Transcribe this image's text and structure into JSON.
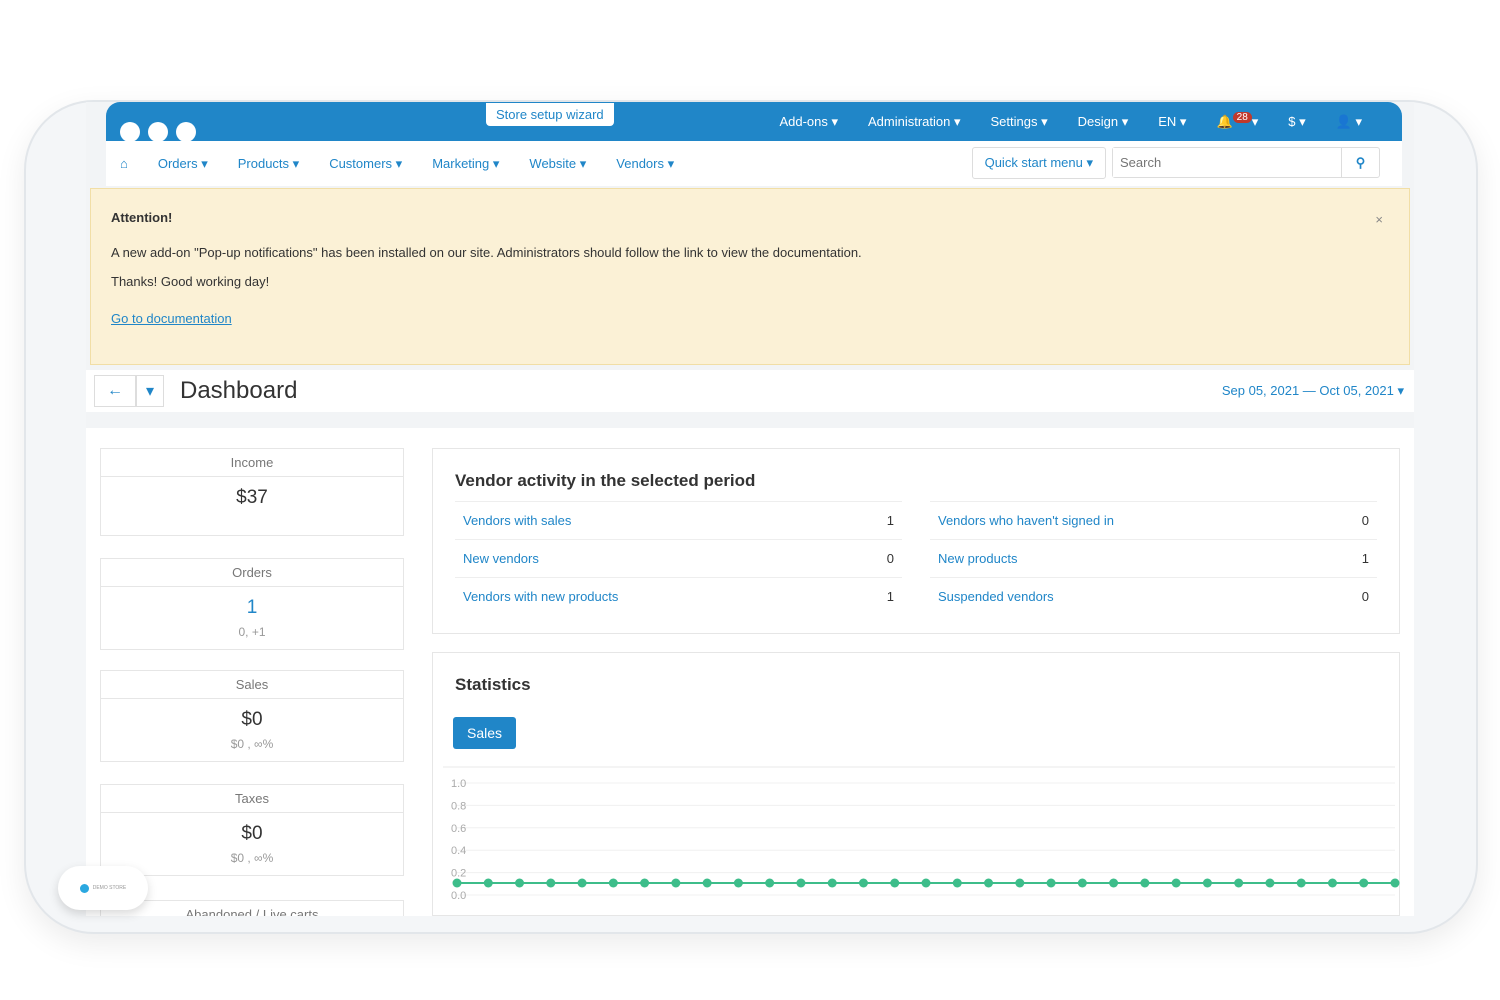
{
  "topbar": {
    "wizard": "Store setup wizard",
    "menu": [
      "Add-ons",
      "Administration",
      "Settings",
      "Design",
      "EN"
    ],
    "notifications": "28",
    "currency": "$"
  },
  "nav": {
    "items": [
      "Orders",
      "Products",
      "Customers",
      "Marketing",
      "Website",
      "Vendors"
    ],
    "quick_start": "Quick start menu",
    "search_placeholder": "Search"
  },
  "alert": {
    "title": "Attention!",
    "message": "A new add-on \"Pop-up notifications\" has been installed on our site. Administrators should follow the link to view the documentation.",
    "thanks": "Thanks! Good working day!",
    "link": "Go to documentation"
  },
  "dashboard": {
    "title": "Dashboard",
    "date_range": "Sep 05, 2021 — Oct 05, 2021"
  },
  "cards": [
    {
      "title": "Income",
      "value": "$37",
      "sub": ""
    },
    {
      "title": "Orders",
      "value": "1",
      "sub": "0, +1"
    },
    {
      "title": "Sales",
      "value": "$0",
      "sub": "$0 , ∞%"
    },
    {
      "title": "Taxes",
      "value": "$0",
      "sub": "$0 , ∞%"
    },
    {
      "title": "Abandoned / Live carts",
      "value": "",
      "sub": ""
    }
  ],
  "vendor_activity": {
    "title": "Vendor activity in the selected period",
    "rows": [
      {
        "label": "Vendors with sales",
        "value": "1"
      },
      {
        "label": "Vendors who haven't signed in",
        "value": "0"
      },
      {
        "label": "New vendors",
        "value": "0"
      },
      {
        "label": "New products",
        "value": "1"
      },
      {
        "label": "Vendors with new products",
        "value": "1"
      },
      {
        "label": "Suspended vendors",
        "value": "0"
      }
    ]
  },
  "statistics": {
    "title": "Statistics",
    "tab": "Sales"
  },
  "demo_badge": "DEMO STORE",
  "chart_data": {
    "type": "line",
    "title": "",
    "xlabel": "",
    "ylabel": "",
    "ylim": [
      0,
      1
    ],
    "yticks": [
      "0.0",
      "0.2",
      "0.4",
      "0.6",
      "0.8",
      "1.0"
    ],
    "series": [
      {
        "name": "Sales",
        "color": "#3dbd8a",
        "values": [
          0,
          0,
          0,
          0,
          0,
          0,
          0,
          0,
          0,
          0,
          0,
          0,
          0,
          0,
          0,
          0,
          0,
          0,
          0,
          0,
          0,
          0,
          0,
          0,
          0,
          0,
          0,
          0,
          0,
          0,
          0
        ]
      }
    ]
  }
}
